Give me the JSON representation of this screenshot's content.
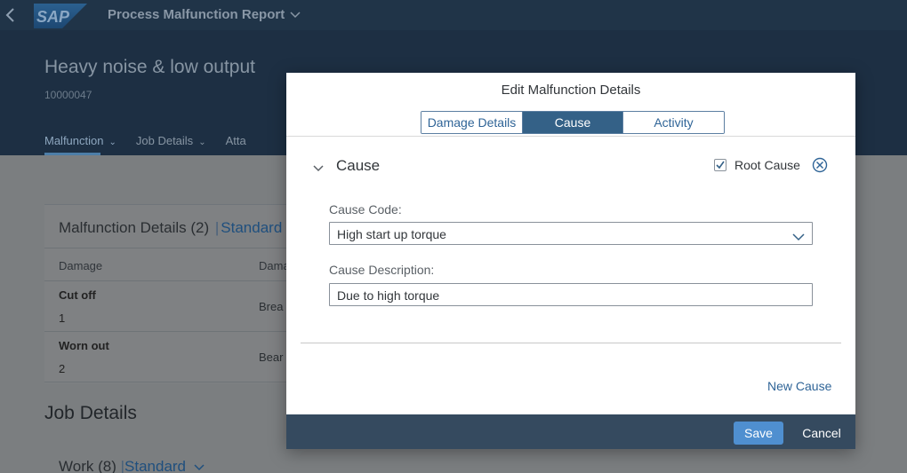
{
  "shell": {
    "app_title": "Process Malfunction Report"
  },
  "header": {
    "title": "Heavy noise & low output",
    "object_id": "10000047",
    "anchors": [
      "Malfunction",
      "Job Details",
      "Atta"
    ]
  },
  "background": {
    "card_title": "Malfunction Details (2)",
    "card_variant": "Standard",
    "columns": [
      "Damage",
      "Dama"
    ],
    "rows": [
      {
        "damage": "Cut off",
        "num": "1",
        "part": "Brea"
      },
      {
        "damage": "Worn out",
        "num": "2",
        "part": "Bear"
      }
    ],
    "section_title": "Job Details",
    "work_title": "Work (8)",
    "work_variant": "Standard"
  },
  "dialog": {
    "title": "Edit Malfunction Details",
    "tabs": [
      "Damage Details",
      "Cause",
      "Activity"
    ],
    "selected_tab": "Cause",
    "panel_title": "Cause",
    "root_cause_label": "Root Cause",
    "root_cause_checked": true,
    "cause_code_label": "Cause Code:",
    "cause_code_value": "High start up torque",
    "cause_desc_label": "Cause Description:",
    "cause_desc_value": "Due to high torque",
    "new_cause_label": "New Cause",
    "save_label": "Save",
    "cancel_label": "Cancel"
  },
  "colors": {
    "shell_bg": "#203448",
    "accent": "#346187",
    "emphasized_button": "#4f8fd0",
    "footer_bg": "#354a5f"
  },
  "icons": [
    "back-icon",
    "sap-logo",
    "chevron-down-icon",
    "checkbox-check-icon",
    "decline-icon"
  ]
}
